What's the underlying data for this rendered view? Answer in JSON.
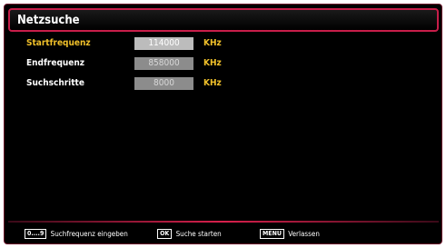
{
  "title": "Netzsuche",
  "fields": [
    {
      "label": "Startfrequenz",
      "value": "114000",
      "unit": "KHz",
      "active": true
    },
    {
      "label": "Endfrequenz",
      "value": "858000",
      "unit": "KHz",
      "active": false
    },
    {
      "label": "Suchschritte",
      "value": "8000",
      "unit": "KHz",
      "active": false
    }
  ],
  "footer": {
    "hint1_key": "0....9",
    "hint1_text": "Suchfrequenz eingeben",
    "hint2_key": "OK",
    "hint2_text": "Suche starten",
    "hint3_key": "MENU",
    "hint3_text": "Verlassen"
  },
  "colors": {
    "accent": "#c81e4a",
    "highlight": "#f0c02a",
    "background": "#000000"
  }
}
